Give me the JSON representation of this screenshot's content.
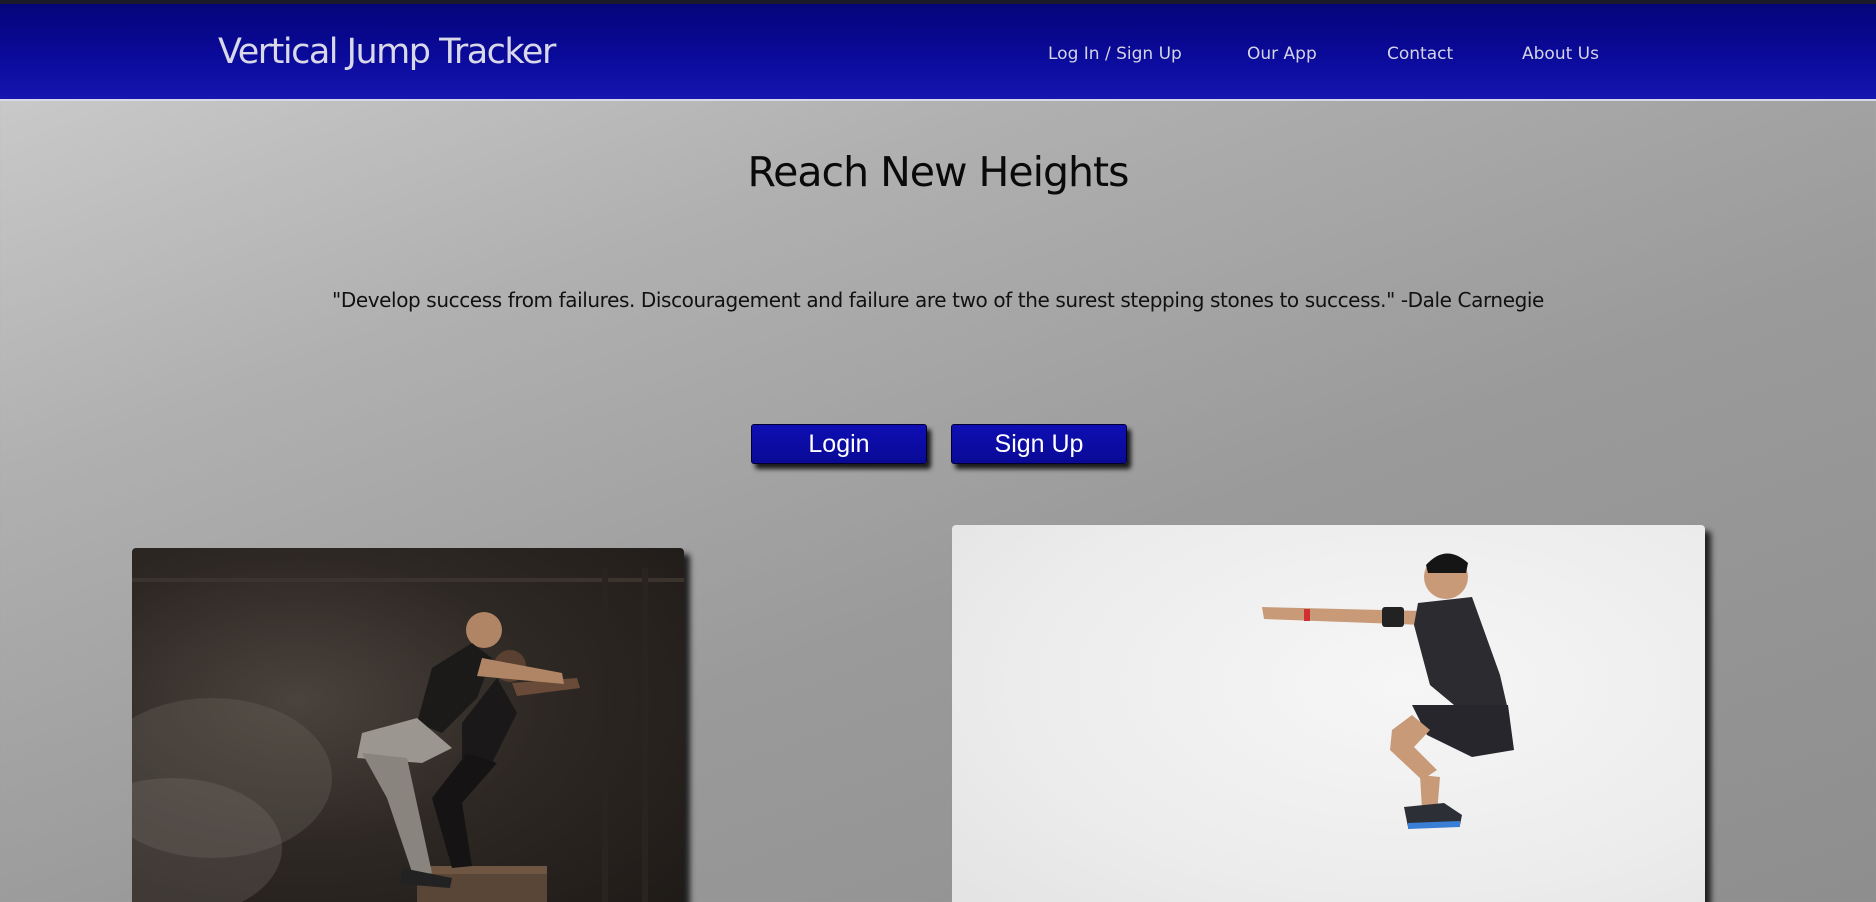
{
  "header": {
    "brand": "Vertical Jump Tracker",
    "nav": [
      {
        "label": "Log In / Sign Up"
      },
      {
        "label": "Our App"
      },
      {
        "label": "Contact"
      },
      {
        "label": "About Us"
      }
    ]
  },
  "hero": {
    "title": "Reach New Heights",
    "quote": "\"Develop success from failures. Discouragement and failure are two of the surest stepping stones to success.\" -Dale Carnegie",
    "buttons": {
      "login": "Login",
      "signup": "Sign Up"
    }
  },
  "images": [
    {
      "subject": "two athletes box-jumping in a dark gym"
    },
    {
      "subject": "man jumping in tuck position against white background"
    }
  ],
  "colors": {
    "nav_bg": "#0a0a9a",
    "button_bg": "#0e0eb4",
    "nav_text": "#d4d4e6"
  }
}
